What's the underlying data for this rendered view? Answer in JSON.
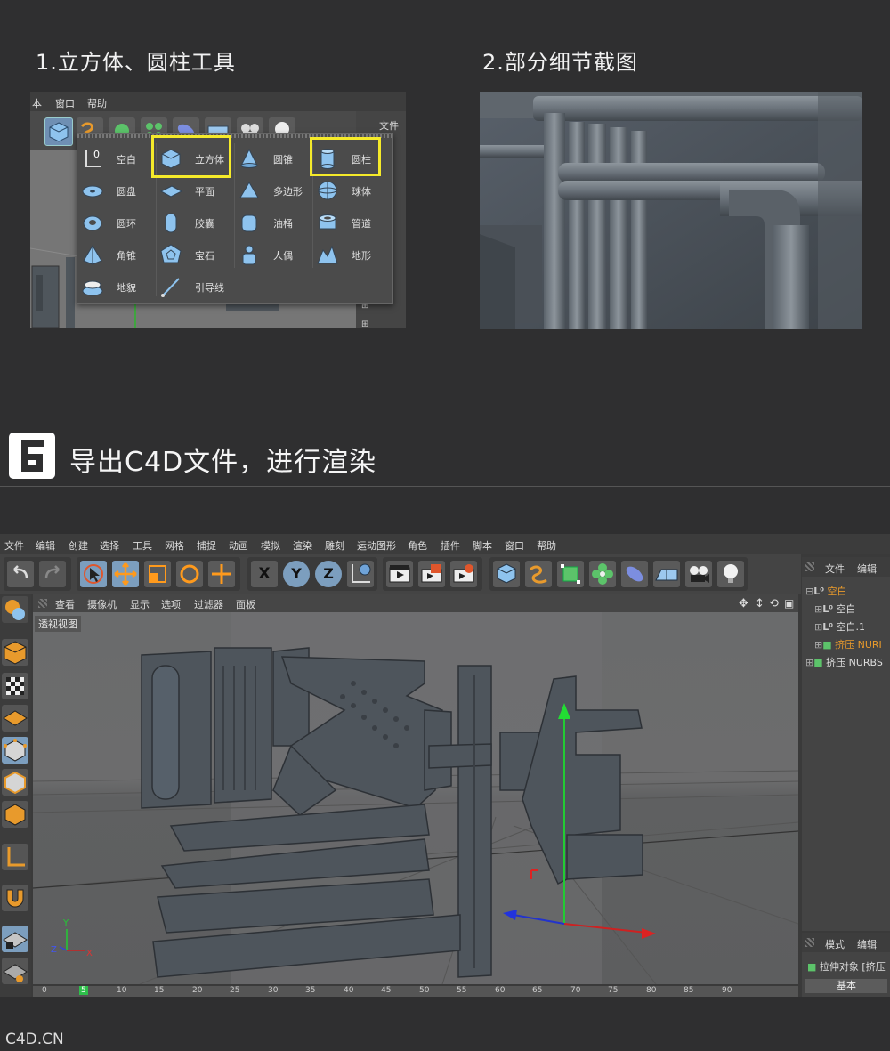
{
  "section1": {
    "title": "1.立方体、圆柱工具"
  },
  "section2": {
    "title": "2.部分细节截图"
  },
  "panel1": {
    "menu": [
      "本",
      "窗口",
      "帮助"
    ],
    "file_label": "文件",
    "popup_items": [
      {
        "label": "空白",
        "icon": "null-object-icon"
      },
      {
        "label": "立方体",
        "icon": "cube-icon"
      },
      {
        "label": "圆锥",
        "icon": "cone-icon"
      },
      {
        "label": "圆柱",
        "icon": "cylinder-icon"
      },
      {
        "label": "圆盘",
        "icon": "disc-icon"
      },
      {
        "label": "平面",
        "icon": "plane-icon"
      },
      {
        "label": "多边形",
        "icon": "polygon-icon"
      },
      {
        "label": "球体",
        "icon": "sphere-icon"
      },
      {
        "label": "圆环",
        "icon": "torus-icon"
      },
      {
        "label": "胶囊",
        "icon": "capsule-icon"
      },
      {
        "label": "油桶",
        "icon": "oil-tank-icon"
      },
      {
        "label": "管道",
        "icon": "tube-icon"
      },
      {
        "label": "角锥",
        "icon": "pyramid-icon"
      },
      {
        "label": "宝石",
        "icon": "platonic-icon"
      },
      {
        "label": "人偶",
        "icon": "figure-icon"
      },
      {
        "label": "地形",
        "icon": "landscape-icon"
      },
      {
        "label": "地貌",
        "icon": "relief-icon"
      },
      {
        "label": "引导线",
        "icon": "guide-icon"
      }
    ],
    "highlight_color": "#f5ea2a"
  },
  "section6": {
    "badge": "6",
    "title": "导出C4D文件，进行渲染"
  },
  "app": {
    "menu": [
      "文件",
      "编辑",
      "创建",
      "选择",
      "工具",
      "网格",
      "捕捉",
      "动画",
      "模拟",
      "渲染",
      "雕刻",
      "运动图形",
      "角色",
      "插件",
      "脚本",
      "窗口",
      "帮助"
    ],
    "axis_buttons": [
      "X",
      "Y",
      "Z"
    ],
    "view_menu": [
      "查看",
      "摄像机",
      "显示",
      "选项",
      "过滤器",
      "面板"
    ],
    "viewport_label": "透视视图",
    "object_panel": {
      "tabs": [
        "文件",
        "编辑"
      ],
      "items": [
        {
          "label": "空白",
          "highlight": true
        },
        {
          "label": "空白",
          "highlight": false
        },
        {
          "label": "空白.1",
          "highlight": false
        },
        {
          "label": "挤压 NURI",
          "highlight": true
        },
        {
          "label": "挤压 NURBS",
          "highlight": false
        }
      ]
    },
    "attr_panel": {
      "tabs": [
        "模式",
        "编辑"
      ],
      "object_label": "拉伸对象 [挤压",
      "tab_basic": "基本"
    },
    "timeline_ticks": [
      "0",
      "5",
      "10",
      "15",
      "20",
      "25",
      "30",
      "35",
      "40",
      "45",
      "50",
      "55",
      "60",
      "65",
      "70",
      "75",
      "80",
      "85",
      "90"
    ],
    "axis_gizmo": {
      "y": "Y",
      "x": "X",
      "z": "Z"
    }
  },
  "footer": {
    "text": "C4D.CN"
  },
  "colors": {
    "accent_orange": "#e89a2c",
    "highlight_yellow": "#f5ea2a",
    "icon_blue": "#7fb8e8"
  }
}
